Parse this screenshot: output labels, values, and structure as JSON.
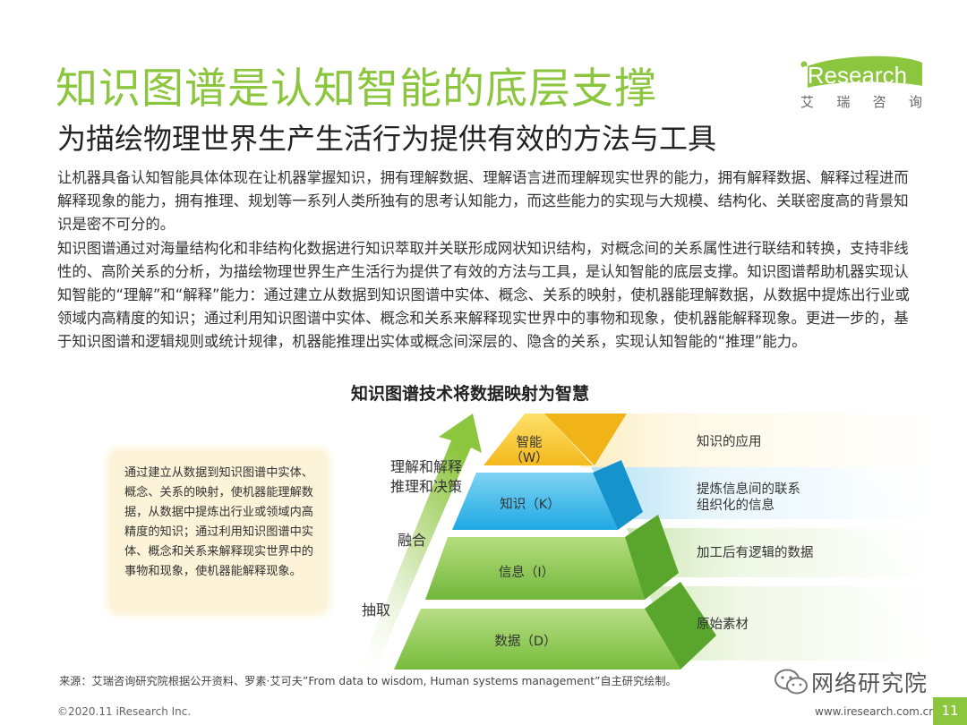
{
  "header": {
    "title": "知识图谱是认知智能的底层支撑",
    "subtitle": "为描绘物理世界生产生活行为提供有效的方法与工具"
  },
  "logo": {
    "wordmark": "iResearch",
    "chars": [
      "艾",
      "瑞",
      "咨",
      "询"
    ],
    "brand_color": "#8cc63f"
  },
  "body": {
    "paragraphs": [
      "让机器具备认知智能具体体现在让机器掌握知识，拥有理解数据、理解语言进而理解现实世界的能力，拥有解释数据、解释过程进而解释现象的能力，拥有推理、规划等一系列人类所独有的思考认知能力，而这些能力的实现与大规模、结构化、关联密度高的背景知识是密不可分的。",
      "知识图谱通过对海量结构化和非结构化数据进行知识萃取并关联形成网状知识结构，对概念间的关系属性进行联结和转换，支持非线性的、高阶关系的分析，为描绘物理世界生产生活行为提供了有效的方法与工具，是认知智能的底层支撑。知识图谱帮助机器实现认知智能的“理解”和“解释”能力：通过建立从数据到知识图谱中实体、概念、关系的映射，使机器能理解数据，从数据中提炼出行业或领域内高精度的知识；通过利用知识图谱中实体、概念和关系来解释现实世界中的事物和现象，使机器能解释现象。更进一步的，基于知识图谱和逻辑规则或统计规律，机器能推理出实体或概念间深层的、隐含的关系，实现认知智能的“推理”能力。"
    ]
  },
  "diagram": {
    "title": "知识图谱技术将数据映射为智慧",
    "note": "通过建立从数据到知识图谱中实体、概念、关系的映射，使机器能理解数据，从数据中提炼出行业或领域内高精度的知识；通过利用知识图谱中实体、概念和关系来解释现实世界中的事物和现象，使机器能解释现象。",
    "stages": {
      "top_line1": "理解和解释",
      "top_line2": "推理和决策",
      "middle": "融合",
      "bottom": "抽取"
    },
    "levels": [
      {
        "label": "智能",
        "code": "（W）",
        "description": "知识的应用"
      },
      {
        "label": "知识（K）",
        "description_line1": "提炼信息间的联系",
        "description_line2": "组织化的信息"
      },
      {
        "label": "信息（I）",
        "description": "加工后有逻辑的数据"
      },
      {
        "label": "数据（D）",
        "description": "原始素材"
      }
    ],
    "colors": {
      "wisdom": "#f6c324",
      "knowledge": "#2bb5e8",
      "information": "#7cc04a",
      "data": "#86c540"
    }
  },
  "footer": {
    "source": "来源：艾瑞咨询研究院根据公开资料、罗素·艾可夫”From data to wisdom, Human systems management”自主研究绘制。",
    "copyright": "©2020.11 iResearch Inc.",
    "website": "www.iresearch.com.cn",
    "page": "11",
    "wechat": "网络研究院"
  }
}
